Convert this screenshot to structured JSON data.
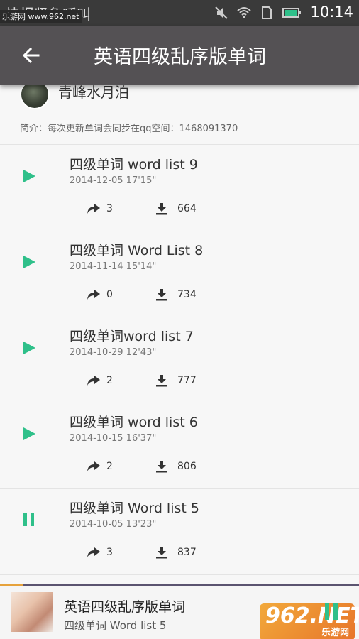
{
  "status_bar": {
    "left_text": "快报紧急呼叫",
    "time": "10:14",
    "watermark": "乐游网 www.962.net",
    "icons": [
      "notification-icon",
      "usb-icon",
      "android-icon",
      "mute-icon",
      "wifi-icon",
      "sim-icon",
      "battery-icon"
    ]
  },
  "app_bar": {
    "title": "英语四级乱序版单词",
    "back_icon": "back-arrow-icon"
  },
  "profile": {
    "author": "青峰水月泊",
    "intro": "简介：每次更新单词会同步在qq空间：1468091370"
  },
  "tracks": [
    {
      "title": "四级单词 word list 9",
      "meta": "2014-12-05  17'15\"",
      "shares": "3",
      "downloads": "664",
      "state": "play"
    },
    {
      "title": "四级单词 Word List 8",
      "meta": "2014-11-14  15'14\"",
      "shares": "0",
      "downloads": "734",
      "state": "play"
    },
    {
      "title": "四级单词word list 7",
      "meta": "2014-10-29  12'43\"",
      "shares": "2",
      "downloads": "777",
      "state": "play"
    },
    {
      "title": "四级单词 word list 6",
      "meta": "2014-10-15  16'37\"",
      "shares": "2",
      "downloads": "806",
      "state": "play"
    },
    {
      "title": "四级单词 Word list 5",
      "meta": "2014-10-05  13'23\"",
      "shares": "3",
      "downloads": "837",
      "state": "pause"
    }
  ],
  "player": {
    "title": "英语四级乱序版单词",
    "subtitle": "四级单词 Word list 5",
    "watermark_big": "962.NET",
    "watermark_small": "乐游网"
  },
  "colors": {
    "accent": "#2fc08a",
    "app_bar": "#545154",
    "progress": "#e6a23c"
  }
}
